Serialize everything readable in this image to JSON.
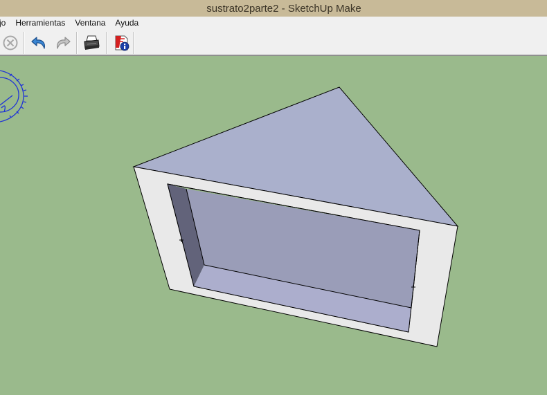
{
  "window": {
    "title": "sustrato2parte2 - SketchUp Make"
  },
  "menubar": {
    "items": [
      {
        "label": "jo"
      },
      {
        "label": "Herramientas"
      },
      {
        "label": "Ventana"
      },
      {
        "label": "Ayuda"
      }
    ]
  },
  "toolbar": {
    "buttons": [
      {
        "icon": "cancel-icon",
        "enabled": false
      },
      {
        "icon": "undo-icon",
        "enabled": true
      },
      {
        "icon": "redo-icon",
        "enabled": false
      },
      {
        "icon": "print-icon",
        "enabled": true
      },
      {
        "icon": "model-info-icon",
        "enabled": true
      }
    ]
  },
  "colors": {
    "background": "#9aba8c",
    "top_face": "#aab0cc",
    "front_face": "#e9e9e9",
    "inner_face": "#9a9db8",
    "inner_left_face": "#62637a",
    "inner_bottom_face": "#acaecd",
    "protractor": "#1f33d6"
  }
}
